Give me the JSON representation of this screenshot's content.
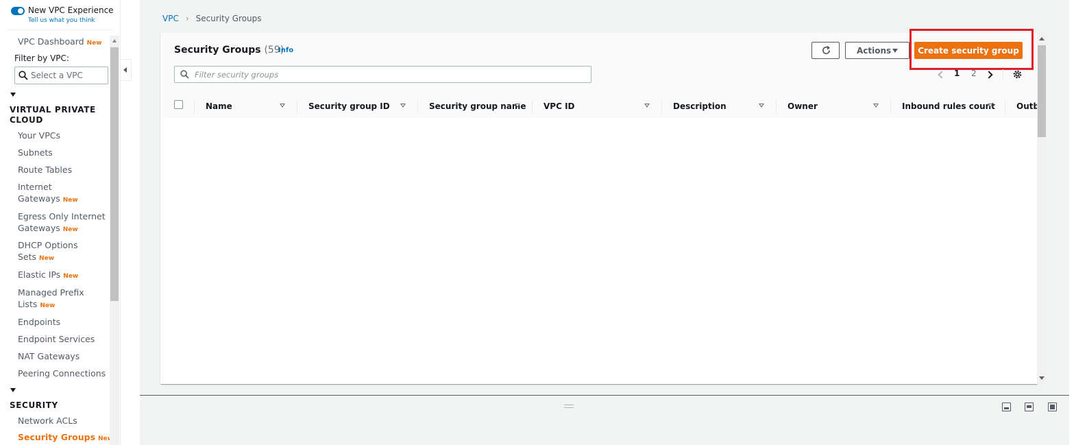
{
  "sidebar": {
    "toggle_label": "New VPC Experience",
    "feedback_link": "Tell us what you think",
    "dashboard": "VPC Dashboard",
    "new_badge": "New",
    "filter_label": "Filter by VPC:",
    "vpc_select_placeholder": "Select a VPC",
    "sections": {
      "vpc": "VIRTUAL PRIVATE CLOUD",
      "security": "SECURITY"
    },
    "items": {
      "your_vpcs": "Your VPCs",
      "subnets": "Subnets",
      "route_tables": "Route Tables",
      "igw_1": "Internet",
      "igw_2": "Gateways",
      "egress_1": "Egress Only Internet",
      "egress_2": "Gateways",
      "dhcp_1": "DHCP Options",
      "dhcp_2": "Sets",
      "elastic_ips": "Elastic IPs",
      "prefix_1": "Managed Prefix",
      "prefix_2": "Lists",
      "endpoints": "Endpoints",
      "endpoint_services": "Endpoint Services",
      "nat_gateways": "NAT Gateways",
      "peering": "Peering Connections",
      "network_acls": "Network ACLs",
      "security_groups": "Security Groups"
    }
  },
  "breadcrumb": {
    "root": "VPC",
    "current": "Security Groups"
  },
  "panel": {
    "title": "Security Groups",
    "count": "(59)",
    "info": "Info",
    "actions_label": "Actions",
    "create_label": "Create security group",
    "filter_placeholder": "Filter security groups",
    "pages": [
      "1",
      "2"
    ]
  },
  "table": {
    "columns": [
      "Name",
      "Security group ID",
      "Security group name",
      "VPC ID",
      "Description",
      "Owner",
      "Inbound rules count",
      "Outb"
    ]
  },
  "colors": {
    "accent": "#ec7211",
    "link": "#0073bb",
    "highlight": "#e01e27"
  }
}
